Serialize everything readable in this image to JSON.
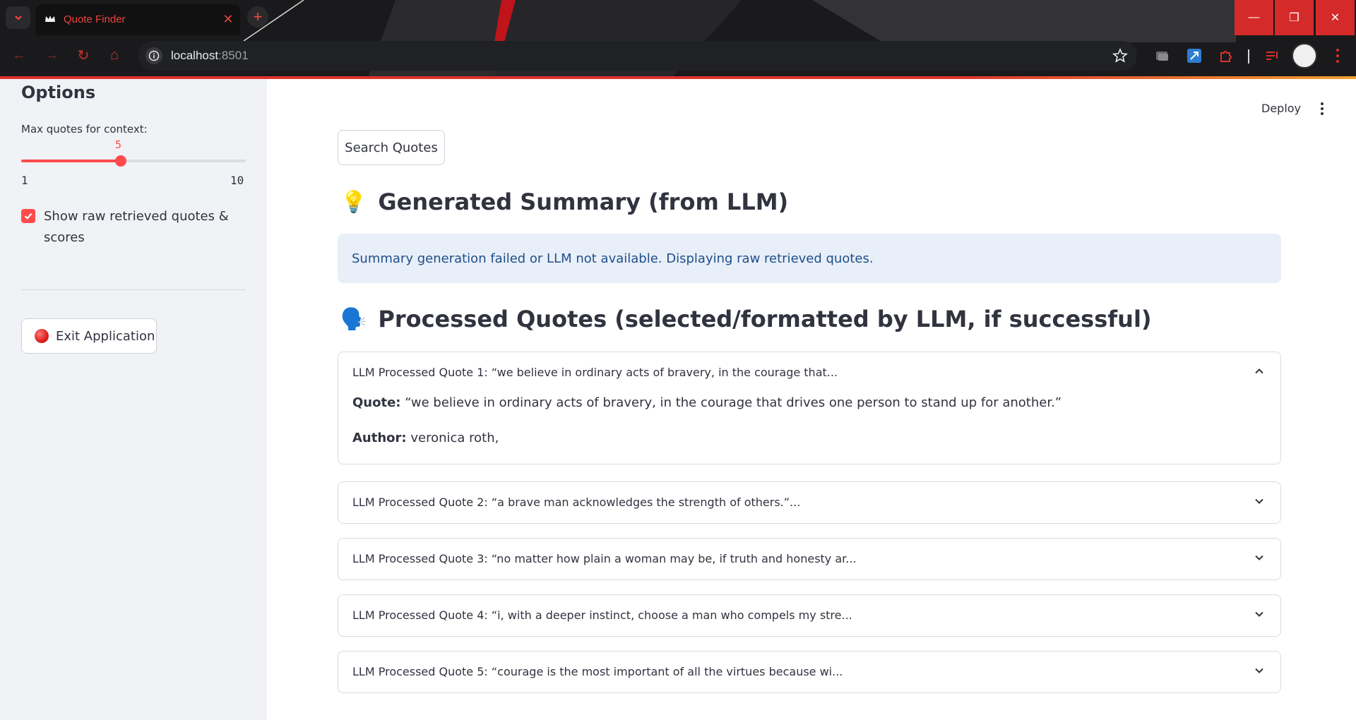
{
  "browser": {
    "tab_title": "Quote Finder",
    "url_host": "localhost",
    "url_port": ":8501"
  },
  "sidebar": {
    "title": "Options",
    "slider": {
      "label": "Max quotes for context:",
      "value": 5,
      "min": 1,
      "max": 10,
      "value_text": "5",
      "min_text": "1",
      "max_text": "10"
    },
    "checkbox": {
      "label": "Show raw retrieved quotes & scores",
      "checked": true
    },
    "exit_button": "Exit Application"
  },
  "header": {
    "deploy_label": "Deploy"
  },
  "main": {
    "search_button": "Search Quotes",
    "summary_heading": "Generated Summary (from LLM)",
    "summary_emoji": "💡",
    "info_message": "Summary generation failed or LLM not available. Displaying raw retrieved quotes.",
    "processed_heading": "Processed Quotes (selected/formatted by LLM, if successful)",
    "processed_emoji": "🗣️",
    "expanders": [
      {
        "title": "LLM Processed Quote 1: “we believe in ordinary acts of bravery, in the courage that...",
        "expanded": true,
        "quote_label": "Quote:",
        "quote_text": "“we believe in ordinary acts of bravery, in the courage that drives one person to stand up for another.”",
        "author_label": "Author:",
        "author_text": "veronica roth,"
      },
      {
        "title": "LLM Processed Quote 2: “a brave man acknowledges the strength of others.”...",
        "expanded": false
      },
      {
        "title": "LLM Processed Quote 3: “no matter how plain a woman may be, if truth and honesty ar...",
        "expanded": false
      },
      {
        "title": "LLM Processed Quote 4: “i, with a deeper instinct, choose a man who compels my stre...",
        "expanded": false
      },
      {
        "title": "LLM Processed Quote 5: “courage is the most important of all the virtues because wi...",
        "expanded": false
      }
    ]
  },
  "colors": {
    "accent": "#ff4b4b",
    "sidebar_bg": "#f0f2f6",
    "info_bg": "#e8eff8",
    "info_text": "#1f4e8a",
    "text": "#31333f"
  }
}
